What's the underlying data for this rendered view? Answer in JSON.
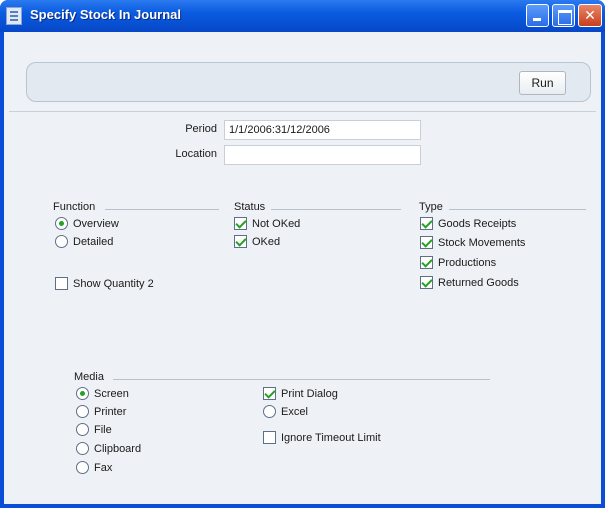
{
  "window": {
    "title": "Specify Stock In Journal"
  },
  "toolbar": {
    "run_label": "Run"
  },
  "form": {
    "period_label": "Period",
    "period_value": "1/1/2006:31/12/2006",
    "location_label": "Location",
    "location_value": ""
  },
  "function": {
    "title": "Function",
    "options": [
      {
        "label": "Overview",
        "selected": true
      },
      {
        "label": "Detailed",
        "selected": false
      }
    ],
    "show_quantity2_label": "Show Quantity 2",
    "show_quantity2_checked": false
  },
  "status": {
    "title": "Status",
    "options": [
      {
        "label": "Not OKed",
        "checked": true
      },
      {
        "label": "OKed",
        "checked": true
      }
    ]
  },
  "type": {
    "title": "Type",
    "options": [
      {
        "label": "Goods Receipts",
        "checked": true
      },
      {
        "label": "Stock Movements",
        "checked": true
      },
      {
        "label": "Productions",
        "checked": true
      },
      {
        "label": "Returned Goods",
        "checked": true
      }
    ]
  },
  "media": {
    "title": "Media",
    "options": [
      {
        "label": "Screen",
        "selected": true
      },
      {
        "label": "Printer",
        "selected": false
      },
      {
        "label": "File",
        "selected": false
      },
      {
        "label": "Clipboard",
        "selected": false
      },
      {
        "label": "Fax",
        "selected": false
      }
    ],
    "print_dialog_label": "Print Dialog",
    "print_dialog_checked": true,
    "excel_label": "Excel",
    "excel_selected": false,
    "ignore_timeout_label": "Ignore Timeout Limit",
    "ignore_timeout_checked": false
  }
}
